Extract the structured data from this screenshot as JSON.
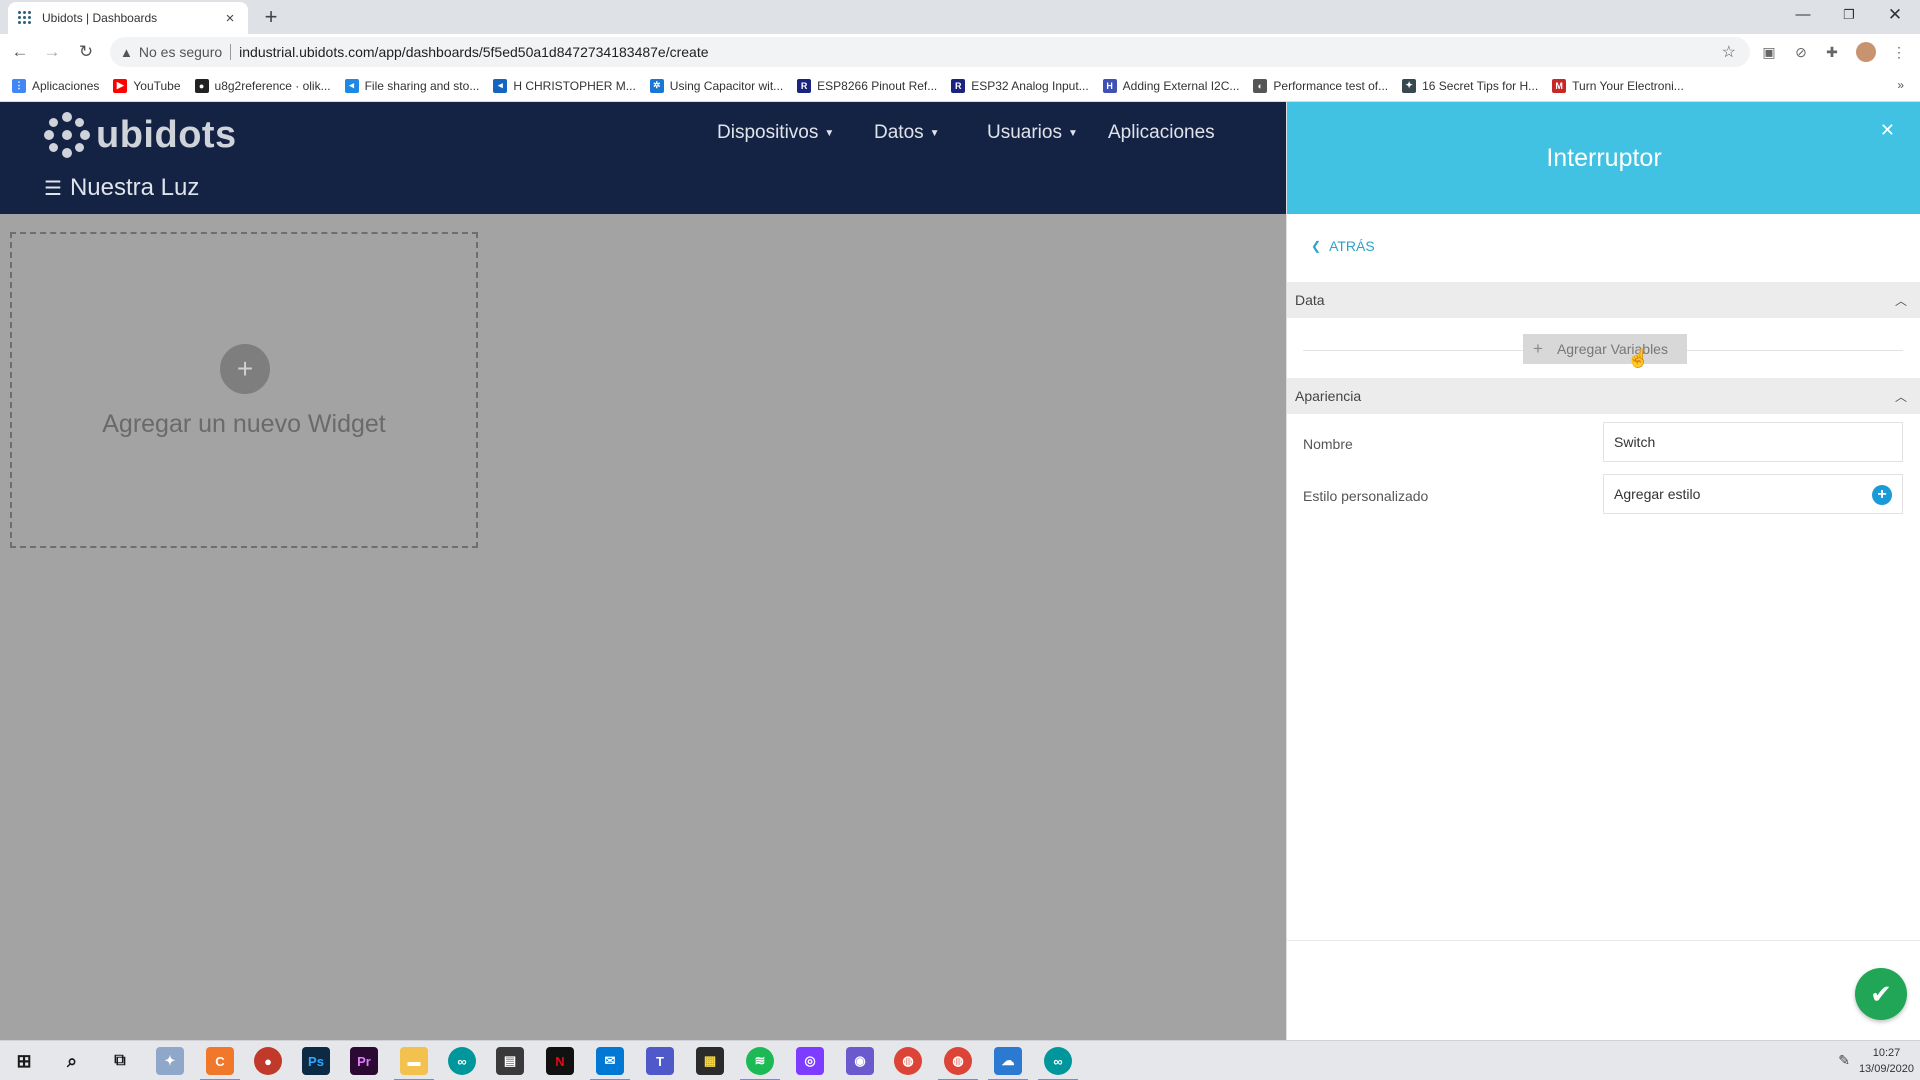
{
  "browser": {
    "tab_title": "Ubidots | Dashboards",
    "tab_close": "×",
    "new_tab": "+",
    "not_secure": "No es seguro",
    "url": "industrial.ubidots.com/app/dashboards/5f5ed50a1d8472734183487e/create",
    "bookmarks": [
      {
        "label": "Aplicaciones",
        "color": "#4285f4",
        "glyph": "⋮"
      },
      {
        "label": "YouTube",
        "color": "#ff0000",
        "glyph": "▶"
      },
      {
        "label": "u8g2reference · olik...",
        "color": "#222222",
        "glyph": "●"
      },
      {
        "label": "File sharing and sto...",
        "color": "#1e88e5",
        "glyph": "◂"
      },
      {
        "label": "H CHRISTOPHER M...",
        "color": "#1565c0",
        "glyph": "◂"
      },
      {
        "label": "Using Capacitor wit...",
        "color": "#1976d2",
        "glyph": "✲"
      },
      {
        "label": "ESP8266 Pinout Ref...",
        "color": "#1a237e",
        "glyph": "R"
      },
      {
        "label": "ESP32 Analog Input...",
        "color": "#1a237e",
        "glyph": "R"
      },
      {
        "label": "Adding External I2C...",
        "color": "#3f51b5",
        "glyph": "H"
      },
      {
        "label": "Performance test of...",
        "color": "#555555",
        "glyph": "◐"
      },
      {
        "label": "16 Secret Tips for H...",
        "color": "#37474f",
        "glyph": "✦"
      },
      {
        "label": "Turn Your Electroni...",
        "color": "#c62828",
        "glyph": "M"
      }
    ],
    "bookmarks_more": "»"
  },
  "header": {
    "logo_text": "ubidots",
    "nav": [
      {
        "label": "Dispositivos",
        "dropdown": true
      },
      {
        "label": "Datos",
        "dropdown": true
      },
      {
        "label": "Usuarios",
        "dropdown": true
      },
      {
        "label": "Aplicaciones",
        "dropdown": false
      }
    ],
    "dashboard_name": "Nuestra Luz"
  },
  "canvas": {
    "add_widget_label": "Agregar un nuevo Widget"
  },
  "panel": {
    "title": "Interruptor",
    "back_label": "ATRÁS",
    "data_section": "Data",
    "add_variables": "Agregar Variables",
    "appearance_section": "Apariencia",
    "name_label": "Nombre",
    "name_value": "Switch",
    "custom_style_label": "Estilo personalizado",
    "custom_style_value": "Agregar estilo"
  },
  "taskbar": {
    "time": "10:27",
    "date": "13/09/2020"
  },
  "colors": {
    "header_bg": "#142243",
    "panel_accent": "#41c2e3",
    "confirm_green": "#21a556",
    "add_style_blue": "#1a9ad6"
  }
}
